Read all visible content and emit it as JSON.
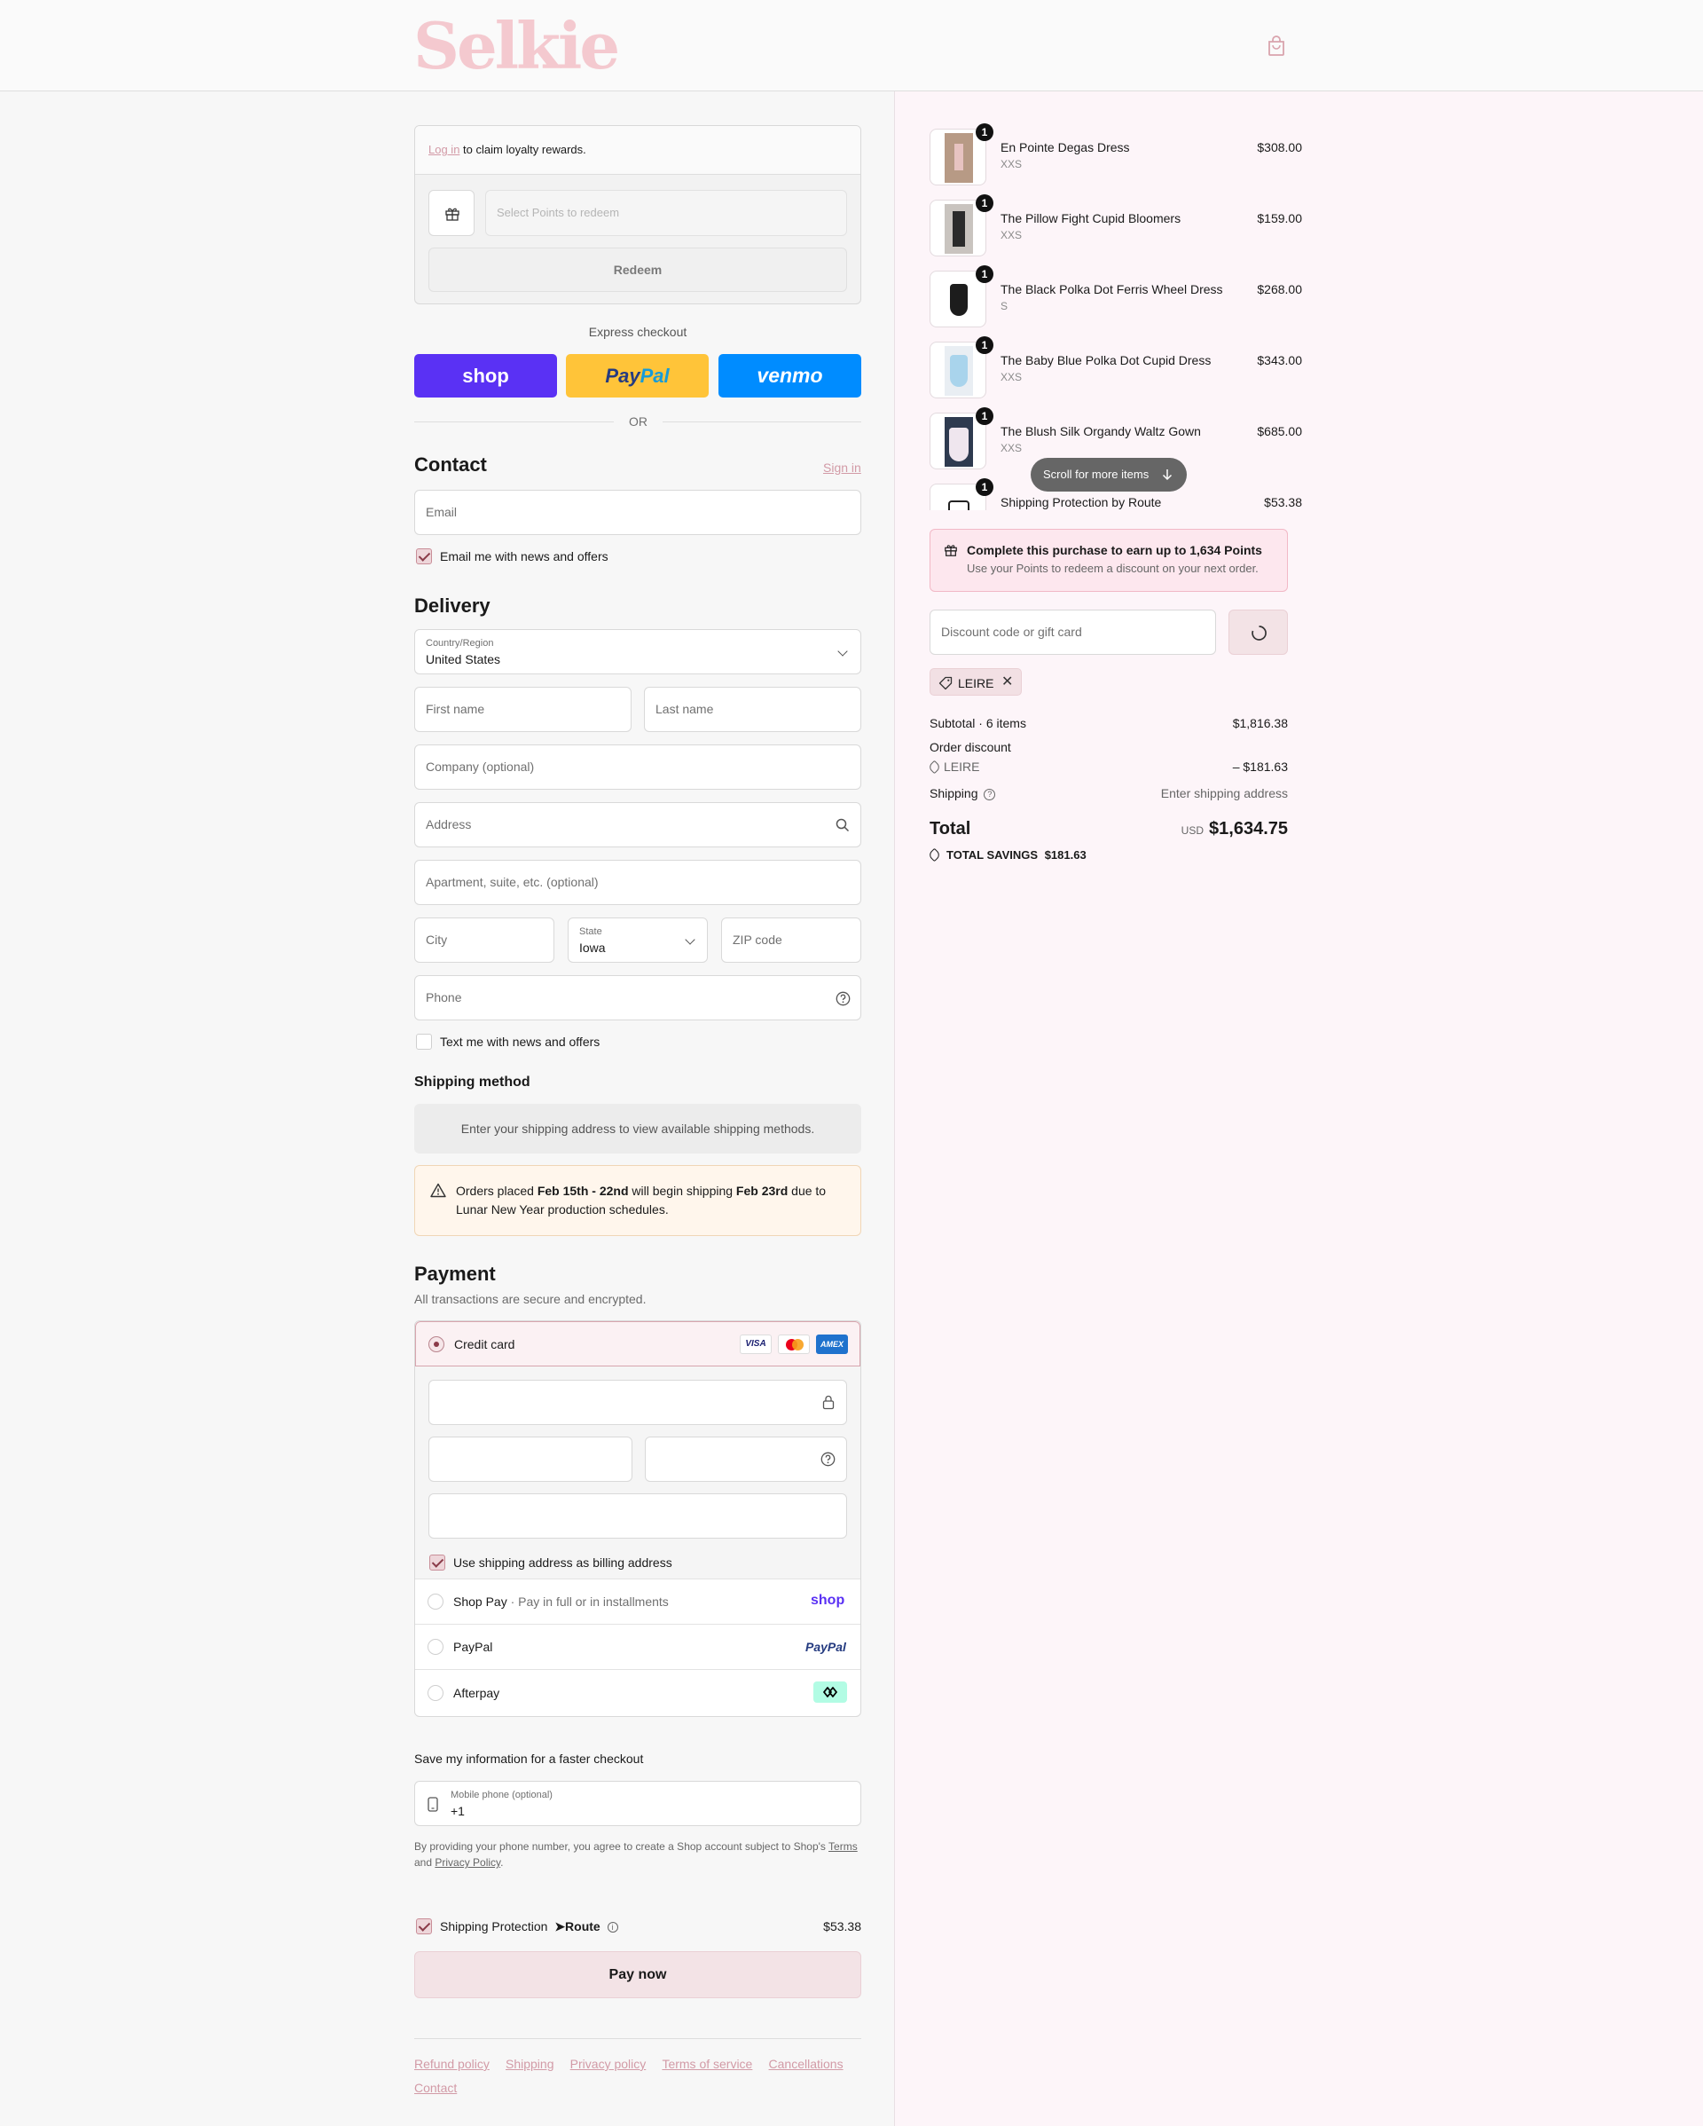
{
  "header": {
    "logo": "Selkie",
    "cart_icon": "bag-icon"
  },
  "loyalty": {
    "login_link": "Log in",
    "login_text": "to claim loyalty rewards.",
    "select_placeholder": "Select Points to redeem",
    "redeem_button": "Redeem"
  },
  "express": {
    "title": "Express checkout",
    "shop_label": "shop",
    "paypal_label_1": "Pay",
    "paypal_label_2": "Pal",
    "venmo_label": "venmo",
    "or_text": "OR"
  },
  "contact": {
    "title": "Contact",
    "sign_in": "Sign in",
    "email_placeholder": "Email",
    "newsletter_label": "Email me with news and offers"
  },
  "delivery": {
    "title": "Delivery",
    "country_label": "Country/Region",
    "country_value": "United States",
    "first_name": "First name",
    "last_name": "Last name",
    "company": "Company (optional)",
    "address": "Address",
    "apartment": "Apartment, suite, etc. (optional)",
    "city": "City",
    "state_label": "State",
    "state_value": "Iowa",
    "zip": "ZIP code",
    "phone": "Phone",
    "sms_label": "Text me with news and offers"
  },
  "shipping_method": {
    "title": "Shipping method",
    "notice": "Enter your shipping address to view available shipping methods.",
    "alert_1": "Orders placed ",
    "alert_bold_1": "Feb 15th - 22nd",
    "alert_2": " will begin shipping ",
    "alert_bold_2": "Feb 23rd",
    "alert_3": " due to",
    "alert_line2": "Lunar New Year production schedules."
  },
  "payment": {
    "title": "Payment",
    "subtitle": "All transactions are secure and encrypted.",
    "credit_card": "Credit card",
    "visa": "VISA",
    "amex": "AMEX",
    "billing_label": "Use shipping address as billing address",
    "shop_pay": "Shop Pay",
    "shop_pay_sub": "Pay in full or in installments",
    "shop_pay_logo": "shop",
    "paypal": "PayPal",
    "paypal_logo": "PayPal",
    "afterpay": "Afterpay"
  },
  "save_info": {
    "title": "Save my information for a faster checkout",
    "phone_label": "Mobile phone (optional)",
    "phone_value": "+1",
    "legal_1": "By providing your phone number, you agree to create a Shop account subject to Shop's ",
    "terms": "Terms",
    "legal_2": "and ",
    "privacy": "Privacy Policy",
    "legal_3": "."
  },
  "protection": {
    "label": "Shipping Protection",
    "brand": "Route",
    "price": "$53.38"
  },
  "pay_now": "Pay now",
  "footer": [
    "Refund policy",
    "Shipping",
    "Privacy policy",
    "Terms of service",
    "Cancellations",
    "Contact"
  ],
  "cart": {
    "items": [
      {
        "name": "En Pointe Degas Dress",
        "variant": "XXS",
        "price": "$308.00",
        "qty": "1"
      },
      {
        "name": "The Pillow Fight Cupid Bloomers",
        "variant": "XXS",
        "price": "$159.00",
        "qty": "1"
      },
      {
        "name": "The Black Polka Dot Ferris Wheel Dress",
        "variant": "S",
        "price": "$268.00",
        "qty": "1"
      },
      {
        "name": "The Baby Blue Polka Dot Cupid Dress",
        "variant": "XXS",
        "price": "$343.00",
        "qty": "1"
      },
      {
        "name": "The Blush Silk Organdy Waltz Gown",
        "variant": "XXS",
        "price": "$685.00",
        "qty": "1"
      },
      {
        "name": "Shipping Protection by Route",
        "variant": "",
        "price": "$53.38",
        "qty": "1"
      }
    ],
    "scroll_hint": "Scroll for more items",
    "points_title": "Complete this purchase to earn up to 1,634 Points",
    "points_sub": "Use your Points to redeem a discount on your next order.",
    "discount_placeholder": "Discount code or gift card",
    "applied_code": "LEIRE",
    "subtotal_label": "Subtotal · 6 items",
    "subtotal_value": "$1,816.38",
    "order_discount_label": "Order discount",
    "discount_code": "LEIRE",
    "discount_value": "– $181.63",
    "shipping_label": "Shipping",
    "shipping_value": "Enter shipping address",
    "total_label": "Total",
    "currency": "USD",
    "total_value": "$1,634.75",
    "savings_label": "TOTAL SAVINGS",
    "savings_value": "$181.63"
  },
  "colors": {
    "accent": "#d29aa6",
    "shop": "#5a31f4",
    "paypal": "#ffc439",
    "venmo": "#008cff",
    "pay_button": "#f3e3e6"
  }
}
